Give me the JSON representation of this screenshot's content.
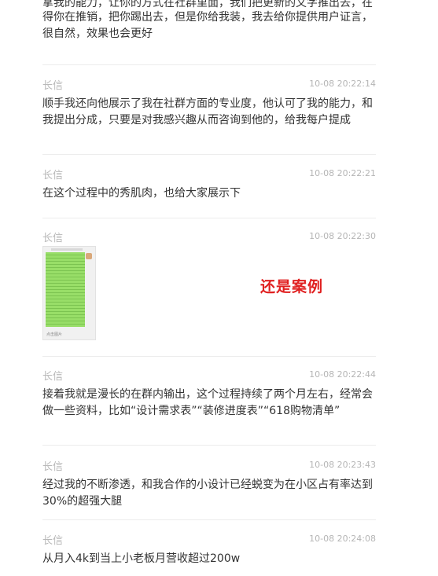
{
  "messages": [
    {
      "author": "",
      "time": "",
      "text": "得你在推销，把你踢出去，但是你给我装，我去给你提供用户证言，很自然，效果也会更好",
      "partial_top": "..."
    },
    {
      "author": "长信",
      "time": "10-08 20:22:14",
      "text": "顺手我还向他展示了我在社群方面的专业度，他认可了我的能力，和我提出分成，只要是对我感兴趣从而咨询到他的，给我每户提成"
    },
    {
      "author": "长信",
      "time": "10-08 20:22:21",
      "text": "在这个过程中的秀肌肉，也给大家展示下"
    },
    {
      "author": "长信",
      "time": "10-08 20:22:30",
      "text": ""
    },
    {
      "author": "长信",
      "time": "10-08 20:22:44",
      "text": "接着我就是漫长的在群内输出，这个过程持续了两个月左右，经常会做一些资料，比如“设计需求表”“装修进度表”“618购物清单”"
    },
    {
      "author": "长信",
      "time": "10-08 20:23:43",
      "text": "经过我的不断渗透，和我合作的小设计已经蜕变为在小区占有率达到30%的超强大腿"
    },
    {
      "author": "长信",
      "time": "10-08 20:24:08",
      "text": "从月入4k到当上小老板月营收超过200w"
    }
  ],
  "image_annotation": "还是案例",
  "thumbnail_footer": "点击图片"
}
